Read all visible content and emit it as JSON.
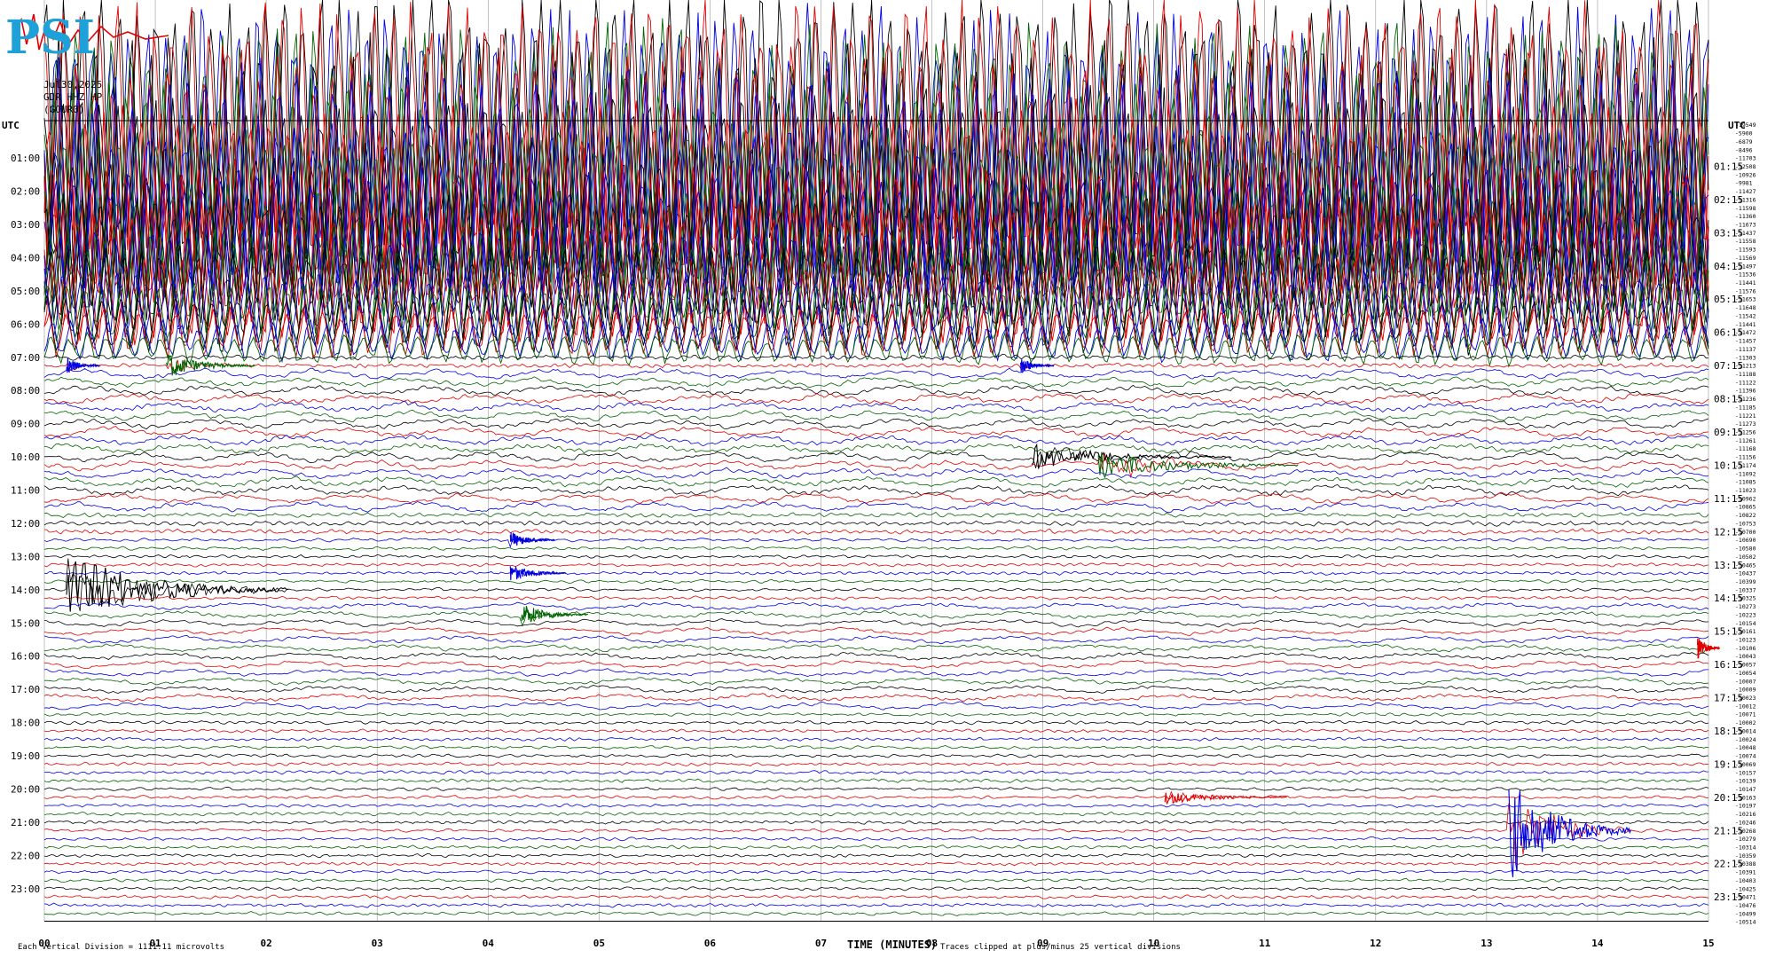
{
  "header": {
    "logo_text": "PSI",
    "date": "Jul30,2025",
    "channel": "GDR HHZ HP",
    "station": "(GOUR0)"
  },
  "footer": {
    "left_note": "Each Vertical Division = 1111.11 microvolts",
    "xaxis_title": "TIME (MINUTES)",
    "clip_note": "Traces clipped at plus/minus 25 vertical divisions"
  },
  "colors": {
    "trace_cycle": [
      "#000000",
      "#e00000",
      "#0000e0",
      "#006400"
    ],
    "grid": "#999999",
    "logo": "#1ea0d8"
  },
  "chart_data": {
    "type": "line",
    "subtype": "helicorder-seismogram",
    "title": "",
    "xlabel": "TIME (MINUTES)",
    "xlim": [
      0,
      15
    ],
    "x_ticks": [
      "00",
      "01",
      "02",
      "03",
      "04",
      "05",
      "06",
      "07",
      "08",
      "09",
      "10",
      "11",
      "12",
      "13",
      "14",
      "15"
    ],
    "left_axis_title": "UTC",
    "right_axis_title": "UTC",
    "left_time_labels": [
      "01:00",
      "02:00",
      "03:00",
      "04:00",
      "05:00",
      "06:00",
      "07:00",
      "08:00",
      "09:00",
      "10:00",
      "11:00",
      "12:00",
      "13:00",
      "14:00",
      "15:00",
      "16:00",
      "17:00",
      "18:00",
      "19:00",
      "20:00",
      "21:00",
      "22:00",
      "23:00"
    ],
    "right_time_labels": [
      "01:15",
      "02:15",
      "03:15",
      "04:15",
      "05:15",
      "06:15",
      "07:15",
      "08:15",
      "09:15",
      "10:15",
      "11:15",
      "12:15",
      "13:15",
      "14:15",
      "15:15",
      "16:15",
      "17:15",
      "18:15",
      "19:15",
      "20:15",
      "21:15",
      "22:15",
      "23:15"
    ],
    "trace_offsets": [
      "-19549",
      "-5900",
      "-6879",
      "-8496",
      "-11703",
      "-12508",
      "-10926",
      "-9981",
      "-11427",
      "-11316",
      "-11598",
      "-11360",
      "-11673",
      "-11437",
      "-11558",
      "-11593",
      "-11569",
      "-11497",
      "-11536",
      "-11441",
      "-11576",
      "-11653",
      "-11648",
      "-11542",
      "-11441",
      "-11472",
      "-11457",
      "-11137",
      "-11303",
      "-11213",
      "-11188",
      "-11122",
      "-11396",
      "-11236",
      "-11185",
      "-11221",
      "-11273",
      "-11256",
      "-11261",
      "-11168",
      "-11156",
      "-11174",
      "-11092",
      "-11085",
      "-11023",
      "-10962",
      "-10865",
      "-10822",
      "-10753",
      "-10700",
      "-10690",
      "-10580",
      "-10502",
      "-10465",
      "-10437",
      "-10399",
      "-10337",
      "-10325",
      "-10273",
      "-10223",
      "-10154",
      "-10161",
      "-10123",
      "-10106",
      "-10043",
      "-10057",
      "-10054",
      "-10007",
      "-10009",
      "-10023",
      "-10012",
      "-10071",
      "-10002",
      "-10014",
      "-10024",
      "-10048",
      "-10074",
      "-10069",
      "-10157",
      "-10139",
      "-10147",
      "-10163",
      "-10197",
      "-10216",
      "-10246",
      "-10268",
      "-10279",
      "-10314",
      "-10359",
      "-10388",
      "-10391",
      "-10403",
      "-10425",
      "-10471",
      "-10476",
      "-10499",
      "-10514"
    ],
    "rows_total": 96,
    "minutes_per_row": 15,
    "scale_microvolts_per_division": 1111.11,
    "clip_divisions": 25,
    "grid": true,
    "events": [
      {
        "row": 29,
        "minute": 1.1,
        "amplitude": 0.9,
        "duration_min": 0.8,
        "color": "#006400"
      },
      {
        "row": 29,
        "minute": 0.2,
        "amplitude": 0.6,
        "duration_min": 0.3,
        "color": "#0000e0"
      },
      {
        "row": 29,
        "minute": 8.8,
        "amplitude": 0.6,
        "duration_min": 0.3,
        "color": "#0000e0"
      },
      {
        "row": 40,
        "minute": 8.9,
        "amplitude": 0.9,
        "duration_min": 1.8,
        "color": "#000000"
      },
      {
        "row": 41,
        "minute": 9.5,
        "amplitude": 1.0,
        "duration_min": 1.8,
        "color": "#006400"
      },
      {
        "row": 50,
        "minute": 4.2,
        "amplitude": 0.6,
        "duration_min": 0.4,
        "color": "#0000e0"
      },
      {
        "row": 54,
        "minute": 4.2,
        "amplitude": 0.6,
        "duration_min": 0.5,
        "color": "#0000e0"
      },
      {
        "row": 56,
        "minute": 0.2,
        "amplitude": 2.5,
        "duration_min": 2.0,
        "color": "#000000"
      },
      {
        "row": 59,
        "minute": 4.3,
        "amplitude": 0.8,
        "duration_min": 0.6,
        "color": "#006400"
      },
      {
        "row": 63,
        "minute": 14.9,
        "amplitude": 0.9,
        "duration_min": 0.2,
        "color": "#e00000"
      },
      {
        "row": 85,
        "minute": 13.2,
        "amplitude": 3.6,
        "duration_min": 1.1,
        "color": "#0000e0"
      },
      {
        "row": 81,
        "minute": 10.1,
        "amplitude": 0.5,
        "duration_min": 1.1,
        "color": "#e00000"
      }
    ],
    "clipped_rows_hours": [
      0,
      7
    ]
  }
}
